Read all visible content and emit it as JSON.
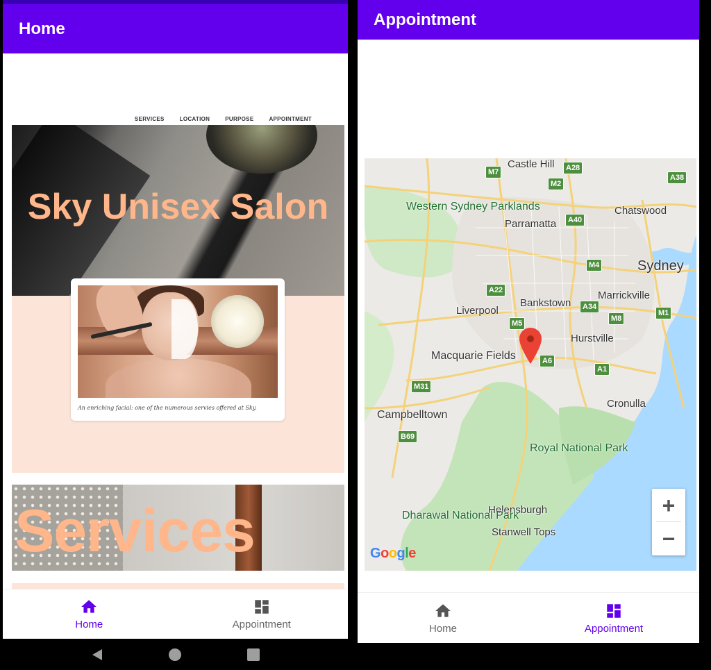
{
  "left_screen": {
    "app_bar": {
      "title": "Home"
    },
    "site_nav": {
      "items": [
        "SERVICES",
        "LOCATION",
        "PURPOSE",
        "APPOINTMENT"
      ]
    },
    "hero": {
      "title": "Sky Unisex Salon"
    },
    "card": {
      "caption": "An enriching facial: one of the numerous servies offered at Sky."
    },
    "services_section": {
      "title": "Services"
    },
    "bottom_nav": {
      "home_label": "Home",
      "appointment_label": "Appointment",
      "active": "Home"
    }
  },
  "right_screen": {
    "app_bar": {
      "title": "Appointment"
    },
    "map": {
      "places": [
        "Castle Hill",
        "Western Sydney Parklands",
        "Parramatta",
        "Chatswood",
        "Sydney",
        "Marrickville",
        "Bankstown",
        "Liverpool",
        "Hurstville",
        "Macquarie Fields",
        "Campbelltown",
        "Cronulla",
        "Royal National Park",
        "Helensburgh",
        "Dharawal National Park",
        "Stanwell Tops"
      ],
      "road_shields": [
        "M7",
        "A28",
        "M2",
        "A38",
        "A40",
        "M4",
        "A22",
        "A34",
        "M1",
        "M8",
        "M5",
        "A6",
        "A1",
        "M31",
        "B69"
      ],
      "attribution": "Google",
      "zoom_in": "+",
      "zoom_out": "−"
    },
    "bottom_nav": {
      "home_label": "Home",
      "appointment_label": "Appointment",
      "active": "Appointment"
    }
  },
  "colors": {
    "primary": "#6200ee",
    "primary_dark": "#3700b3",
    "salon_peach": "#ffb68a",
    "peach_bg": "#fde4d8"
  }
}
